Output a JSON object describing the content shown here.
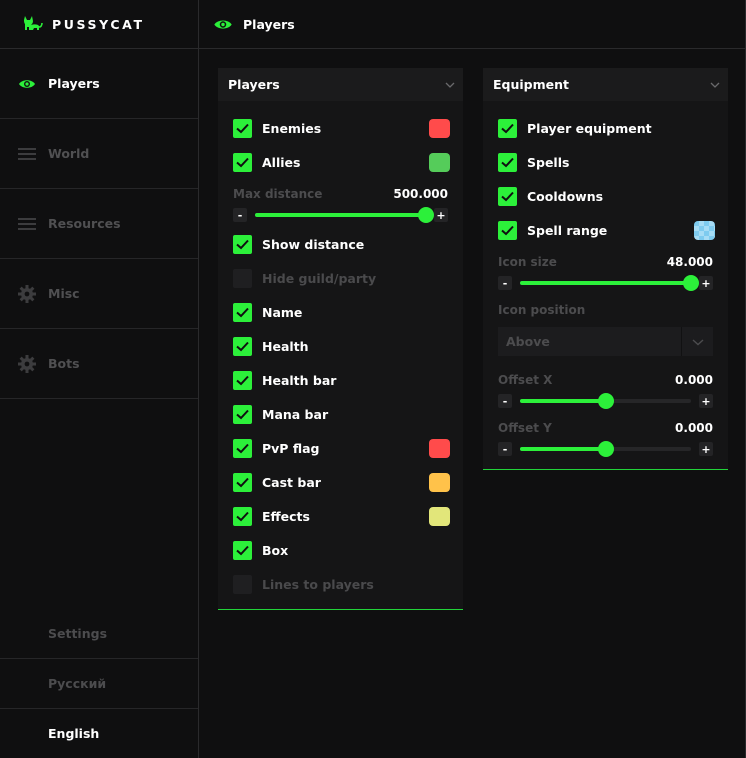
{
  "brand": {
    "title": "PUSSYCAT"
  },
  "sidebar": {
    "items": [
      {
        "label": "Players",
        "icon": "eye-icon",
        "active": true
      },
      {
        "label": "World",
        "icon": "menu-icon",
        "active": false
      },
      {
        "label": "Resources",
        "icon": "menu-icon",
        "active": false
      },
      {
        "label": "Misc",
        "icon": "gear-icon",
        "active": false
      },
      {
        "label": "Bots",
        "icon": "gear-icon",
        "active": false
      }
    ],
    "bottom": [
      {
        "label": "Settings"
      },
      {
        "label": "Русский"
      },
      {
        "label": "English"
      }
    ]
  },
  "header": {
    "title": "Players"
  },
  "players_panel": {
    "title": "Players",
    "enemies": {
      "label": "Enemies",
      "checked": true,
      "color": "#ff4b4b"
    },
    "allies": {
      "label": "Allies",
      "checked": true,
      "color": "#55cc5a"
    },
    "max_distance": {
      "label": "Max distance",
      "value": "500.000",
      "fraction": 1.0
    },
    "show_distance": {
      "label": "Show distance",
      "checked": true
    },
    "hide_guild": {
      "label": "Hide guild/party",
      "checked": false
    },
    "name": {
      "label": "Name",
      "checked": true
    },
    "health": {
      "label": "Health",
      "checked": true
    },
    "health_bar": {
      "label": "Health bar",
      "checked": true
    },
    "mana_bar": {
      "label": "Mana bar",
      "checked": true
    },
    "pvp_flag": {
      "label": "PvP flag",
      "checked": true,
      "color": "#ff4b4b"
    },
    "cast_bar": {
      "label": "Cast bar",
      "checked": true,
      "color": "#ffc24a"
    },
    "effects": {
      "label": "Effects",
      "checked": true,
      "color": "#e2e67a"
    },
    "box": {
      "label": "Box",
      "checked": true
    },
    "lines": {
      "label": "Lines to players",
      "checked": false
    }
  },
  "equipment_panel": {
    "title": "Equipment",
    "player_equipment": {
      "label": "Player equipment",
      "checked": true
    },
    "spells": {
      "label": "Spells",
      "checked": true
    },
    "cooldowns": {
      "label": "Cooldowns",
      "checked": true
    },
    "spell_range": {
      "label": "Spell range",
      "checked": true,
      "color": "#7ecbef"
    },
    "icon_size": {
      "label": "Icon size",
      "value": "48.000",
      "fraction": 1.0
    },
    "icon_position": {
      "label": "Icon position",
      "value": "Above"
    },
    "offset_x": {
      "label": "Offset X",
      "value": "0.000",
      "fraction": 0.5
    },
    "offset_y": {
      "label": "Offset Y",
      "value": "0.000",
      "fraction": 0.5
    }
  },
  "stepper": {
    "minus": "-",
    "plus": "+"
  },
  "colors": {
    "accent": "#2cf03a",
    "background": "#0f0f10"
  }
}
